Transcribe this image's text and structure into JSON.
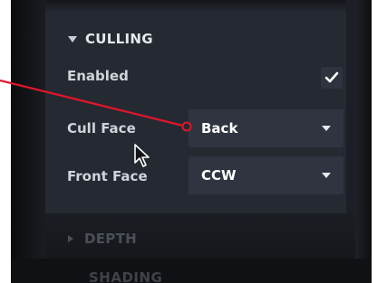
{
  "inspector": {
    "culling": {
      "title": "CULLING",
      "enabled_label": "Enabled",
      "enabled": true,
      "cull_face_label": "Cull Face",
      "cull_face_value": "Back",
      "front_face_label": "Front Face",
      "front_face_value": "CCW"
    },
    "depth": {
      "title": "DEPTH"
    },
    "shading": {
      "title": "SHADING"
    }
  },
  "icons": {
    "culling_expand": "triangle-down-icon",
    "depth_expand": "triangle-right-icon",
    "checkbox": "checkmark-icon",
    "dropdown": "chevron-down-icon",
    "cursor": "mouse-pointer-icon"
  },
  "colors": {
    "annotation": "#e0162b",
    "panel": "#252932",
    "field": "#2f3440"
  }
}
